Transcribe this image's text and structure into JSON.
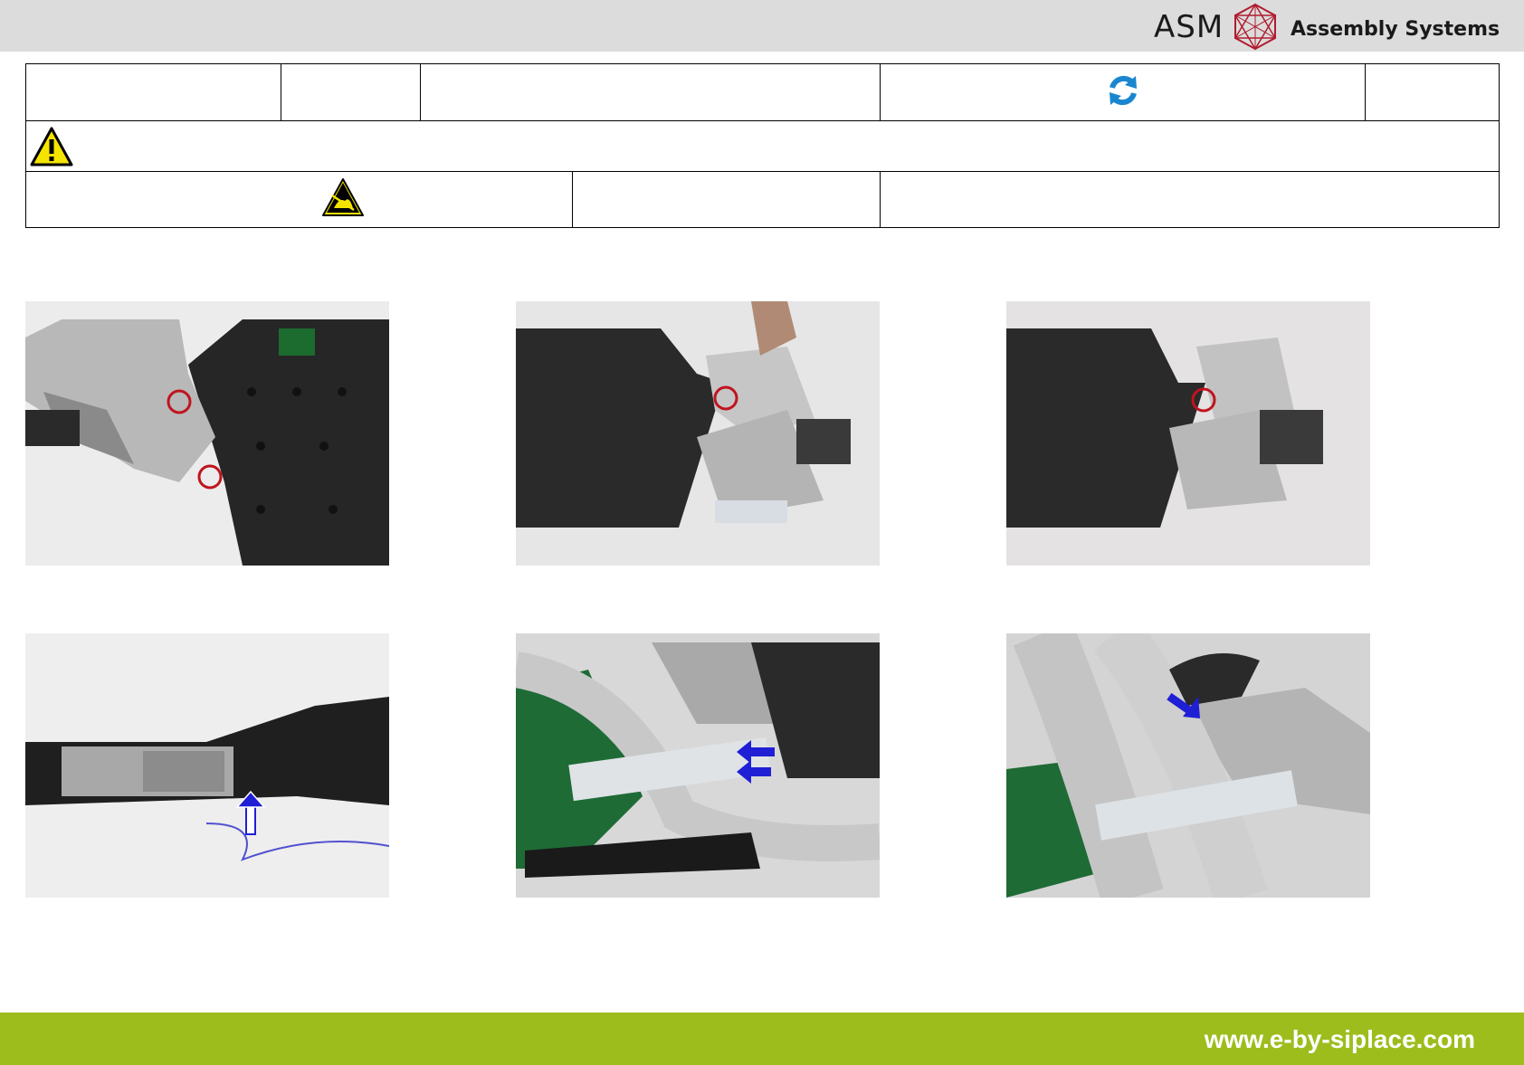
{
  "header": {
    "brand": "ASM",
    "brand_sub": "Assembly Systems"
  },
  "icons": {
    "refresh": "refresh-icon",
    "warning": "warning-icon",
    "esd": "esd-icon",
    "arrow": "arrow-icon",
    "marker": "circle-marker"
  },
  "colors": {
    "topbar": "#dcdcdc",
    "footer": "#9dbd1d",
    "marker": "#c0141e",
    "arrow": "#1f1fd6",
    "refresh": "#1a86d0"
  },
  "footer": {
    "url": "www.e-by-siplace.com"
  }
}
